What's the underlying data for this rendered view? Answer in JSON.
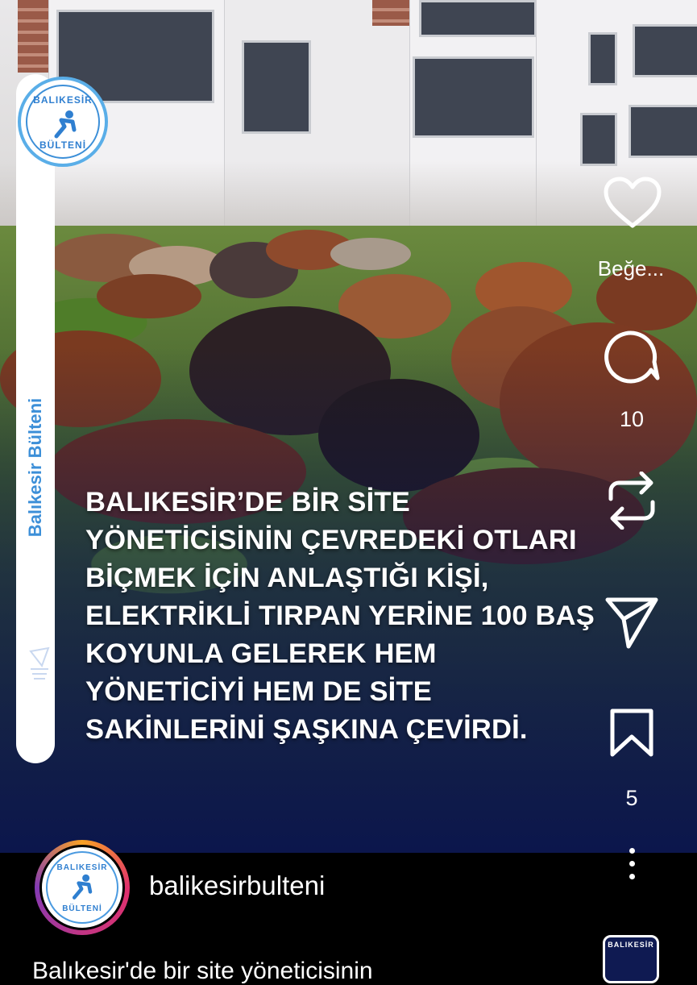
{
  "post": {
    "headline_lines": [
      "BALIKESİR’DE BİR SİTE",
      "YÖNETİCİSİNİN ÇEVREDEKİ OTLARI",
      "BİÇMEK İÇİN ANLAŞTIĞI KİŞİ,",
      "ELEKTRİKLİ TIRPAN YERİNE 100 BAŞ",
      "KOYUNLA GELEREK HEM",
      "YÖNETİCİYİ HEM DE SİTE",
      "SAKİNLERİNİ ŞAŞKINA ÇEVİRDİ."
    ],
    "sidebar_text": "Balıkesir Bülteni",
    "logo_top": "BALIKESİR",
    "logo_bottom": "BÜLTENİ"
  },
  "actions": {
    "like_label": "Beğe...",
    "comment_count": "10",
    "save_count": "5"
  },
  "footer": {
    "username": "balikesirbulteni",
    "caption_partial": "Balıkesir'de bir site yöneticisinin"
  },
  "colors": {
    "overlay": "#0c164e",
    "accent_blue": "#3c8fd8",
    "story_ring": [
      "#f9a225",
      "#e1306c",
      "#833ab4"
    ]
  },
  "icons": [
    "heart-icon",
    "comment-icon",
    "repost-icon",
    "share-icon",
    "bookmark-icon",
    "more-icon"
  ]
}
